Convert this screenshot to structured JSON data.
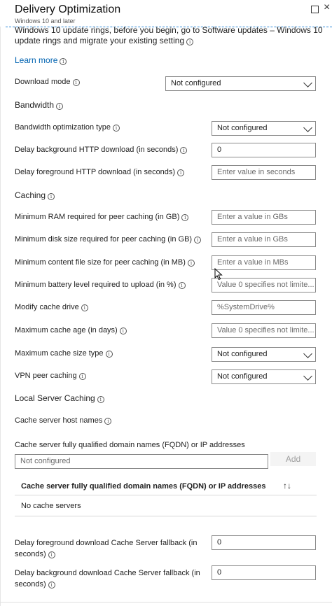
{
  "header": {
    "title": "Delivery Optimization",
    "subtitle": "Windows 10 and later"
  },
  "intro": {
    "text": "Windows 10 update rings, before you begin, go to Software updates – Windows 10 update rings and migrate your existing setting",
    "learn_more": "Learn more"
  },
  "download_mode": {
    "label": "Download mode",
    "value": "Not configured"
  },
  "bandwidth": {
    "title": "Bandwidth",
    "optimization_type": {
      "label": "Bandwidth optimization type",
      "value": "Not configured"
    },
    "delay_bg_http": {
      "label": "Delay background HTTP download (in seconds)",
      "value": "0"
    },
    "delay_fg_http": {
      "label": "Delay foreground HTTP download (in seconds)",
      "placeholder": "Enter value in seconds"
    }
  },
  "caching": {
    "title": "Caching",
    "min_ram": {
      "label": "Minimum RAM required for peer caching (in GB)",
      "placeholder": "Enter a value in GBs"
    },
    "min_disk": {
      "label": "Minimum disk size required for peer caching (in GB)",
      "placeholder": "Enter a value in GBs"
    },
    "min_content": {
      "label": "Minimum content file size for peer caching (in MB)",
      "placeholder": "Enter a value in MBs"
    },
    "min_battery": {
      "label": "Minimum battery level required to upload (in %)",
      "placeholder": "Value 0 specifies not limite..."
    },
    "cache_drive": {
      "label": "Modify cache drive",
      "placeholder": "%SystemDrive%"
    },
    "max_age": {
      "label": "Maximum cache age (in days)",
      "placeholder": "Value 0 specifies not limite..."
    },
    "max_size_type": {
      "label": "Maximum cache size type",
      "value": "Not configured"
    },
    "vpn": {
      "label": "VPN peer caching",
      "value": "Not configured"
    }
  },
  "local_server": {
    "title": "Local Server Caching",
    "host_names": "Cache server host names",
    "fqdn_label": "Cache server fully qualified domain names (FQDN) or IP addresses",
    "fqdn_placeholder": "Not configured",
    "add_label": "Add",
    "table_header": "Cache server fully qualified domain names (FQDN) or IP addresses",
    "table_empty": "No cache servers",
    "fg_fallback": {
      "label_line1": "Delay foreground download Cache Server fallback (in",
      "label_line2": "seconds)",
      "value": "0"
    },
    "bg_fallback": {
      "label_line1": "Delay background download Cache Server fallback (in",
      "label_line2": "seconds)",
      "value": "0"
    }
  },
  "icons": {
    "info": "info-icon",
    "chevron": "chevron-down-icon",
    "sort": "sort-icon",
    "maximize": "maximize-icon",
    "close": "close-icon"
  },
  "colors": {
    "link": "#0063b1",
    "accent_dash": "#2b88d8",
    "field_border": "#8a8a8a",
    "disabled_text": "#a0a0a0"
  }
}
